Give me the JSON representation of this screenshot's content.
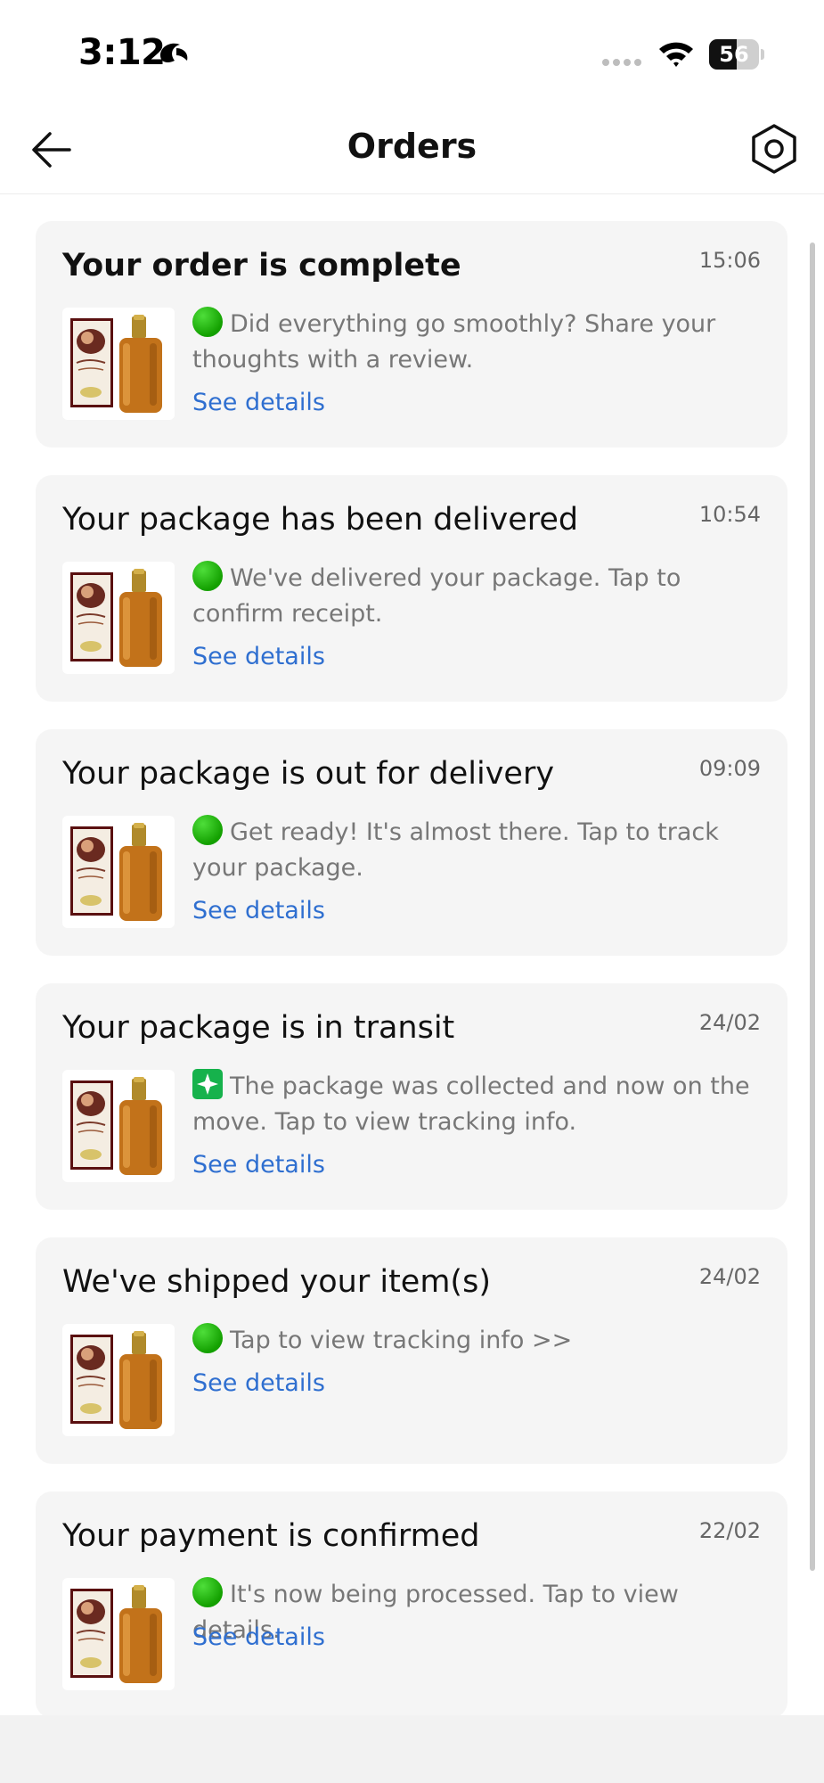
{
  "status_bar": {
    "time": "3:12",
    "battery": "56",
    "battery_level": 0.56
  },
  "header": {
    "title": "Orders"
  },
  "icons": {
    "back": "arrow-left-icon",
    "settings": "hexagon-settings-icon",
    "status_green": "green-circle-emoji",
    "status_sparkle": "sparkle-emoji"
  },
  "colors": {
    "link": "#2f6fd0",
    "card_bg": "#f5f5f5",
    "secondary_text": "#777777"
  },
  "orders": [
    {
      "title": "Your order is complete",
      "time": "15:06",
      "message": "Did everything go smoothly? Share your thoughts with a review.",
      "emoji": "green-circle-emoji",
      "link": "See details",
      "bold": true
    },
    {
      "title": "Your package has been delivered",
      "time": "10:54",
      "message": "We've delivered your package. Tap to confirm receipt.",
      "emoji": "green-circle-emoji",
      "link": "See details",
      "bold": false
    },
    {
      "title": "Your package is out for delivery",
      "time": "09:09",
      "message": "Get ready! It's almost there. Tap to track your package.",
      "emoji": "green-circle-emoji",
      "link": "See details",
      "bold": false
    },
    {
      "title": "Your package is in transit",
      "time": "24/02",
      "message": "The package was collected and now on the move. Tap to view tracking info.",
      "emoji": "sparkle-emoji",
      "link": "See details",
      "bold": false
    },
    {
      "title": "We've shipped your item(s)",
      "time": "24/02",
      "message": "Tap to view tracking info >>",
      "emoji": "green-circle-emoji",
      "link": "See details",
      "bold": false
    },
    {
      "title": "Your payment is confirmed",
      "time": "22/02",
      "message": "It's now being processed. Tap to view details.",
      "emoji": "green-circle-emoji",
      "link": "See details",
      "bold": false
    }
  ]
}
